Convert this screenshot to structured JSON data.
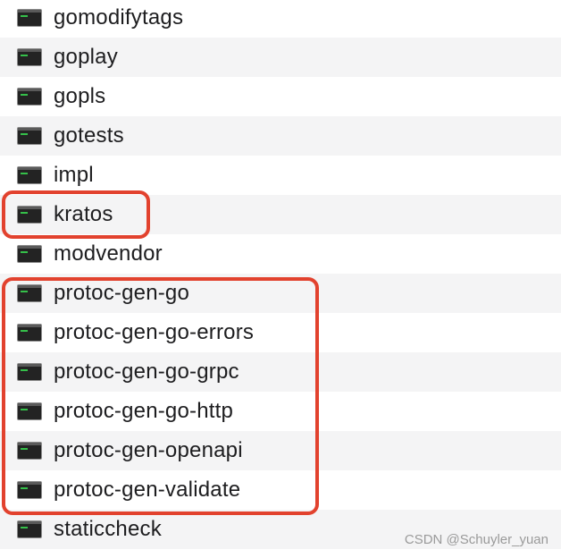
{
  "files": [
    {
      "name": "gomodifytags",
      "icon": "terminal-executable-icon"
    },
    {
      "name": "goplay",
      "icon": "terminal-executable-icon"
    },
    {
      "name": "gopls",
      "icon": "terminal-executable-icon"
    },
    {
      "name": "gotests",
      "icon": "terminal-executable-icon"
    },
    {
      "name": "impl",
      "icon": "terminal-executable-icon"
    },
    {
      "name": "kratos",
      "icon": "terminal-executable-icon"
    },
    {
      "name": "modvendor",
      "icon": "terminal-executable-icon"
    },
    {
      "name": "protoc-gen-go",
      "icon": "terminal-executable-icon"
    },
    {
      "name": "protoc-gen-go-errors",
      "icon": "terminal-executable-icon"
    },
    {
      "name": "protoc-gen-go-grpc",
      "icon": "terminal-executable-icon"
    },
    {
      "name": "protoc-gen-go-http",
      "icon": "terminal-executable-icon"
    },
    {
      "name": "protoc-gen-openapi",
      "icon": "terminal-executable-icon"
    },
    {
      "name": "protoc-gen-validate",
      "icon": "terminal-executable-icon"
    },
    {
      "name": "staticcheck",
      "icon": "terminal-executable-icon"
    }
  ],
  "highlight_color": "#e2422e",
  "watermark": "CSDN @Schuyler_yuan"
}
